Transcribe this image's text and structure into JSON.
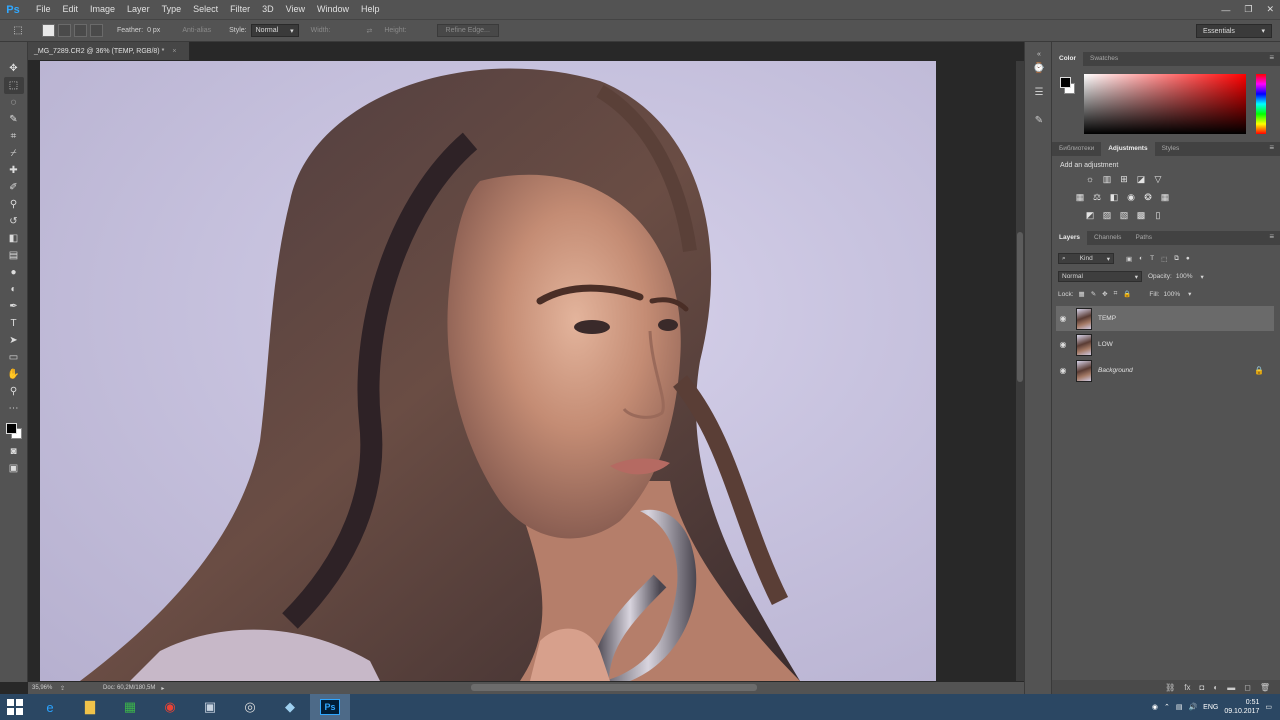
{
  "app": {
    "logo": "Ps"
  },
  "menu": [
    "File",
    "Edit",
    "Image",
    "Layer",
    "Type",
    "Select",
    "Filter",
    "3D",
    "View",
    "Window",
    "Help"
  ],
  "window_controls": {
    "minimize": "—",
    "restore": "❐",
    "close": "✕"
  },
  "options": {
    "feather_label": "Feather:",
    "feather_value": "0 px",
    "antialias_label": "Anti-alias",
    "style_label": "Style:",
    "style_value": "Normal",
    "width_label": "Width:",
    "height_label": "Height:",
    "refine_edge": "Refine Edge...",
    "workspace": "Essentials"
  },
  "document": {
    "tab_title": "_MG_7289.CR2 @ 36% (TEMP, RGB/8) *",
    "close": "×",
    "zoom": "35,96%",
    "doc_info": "Doc: 60,2M/180,5M"
  },
  "colors": {
    "foreground": "#000000",
    "background": "#ffffff",
    "hue_top": "#ff0000"
  },
  "panels": {
    "color_tabs": [
      "Color",
      "Swatches"
    ],
    "adj_tabs": [
      "Библиотеки",
      "Adjustments",
      "Styles"
    ],
    "add_adjustment": "Add an adjustment",
    "layer_tabs": [
      "Layers",
      "Channels",
      "Paths"
    ],
    "kind_label": "Kind",
    "blend_mode": "Normal",
    "opacity_label": "Opacity:",
    "opacity_value": "100%",
    "lock_label": "Lock:",
    "fill_label": "Fill:",
    "fill_value": "100%"
  },
  "layers": [
    {
      "name": "TEMP",
      "selected": true,
      "italic": false,
      "locked": false
    },
    {
      "name": "LOW",
      "selected": false,
      "italic": false,
      "locked": false
    },
    {
      "name": "Background",
      "selected": false,
      "italic": true,
      "locked": true
    }
  ],
  "taskbar": {
    "ps_label": "Ps",
    "lang": "ENG",
    "time": "0:51",
    "date": "09.10.2017"
  }
}
